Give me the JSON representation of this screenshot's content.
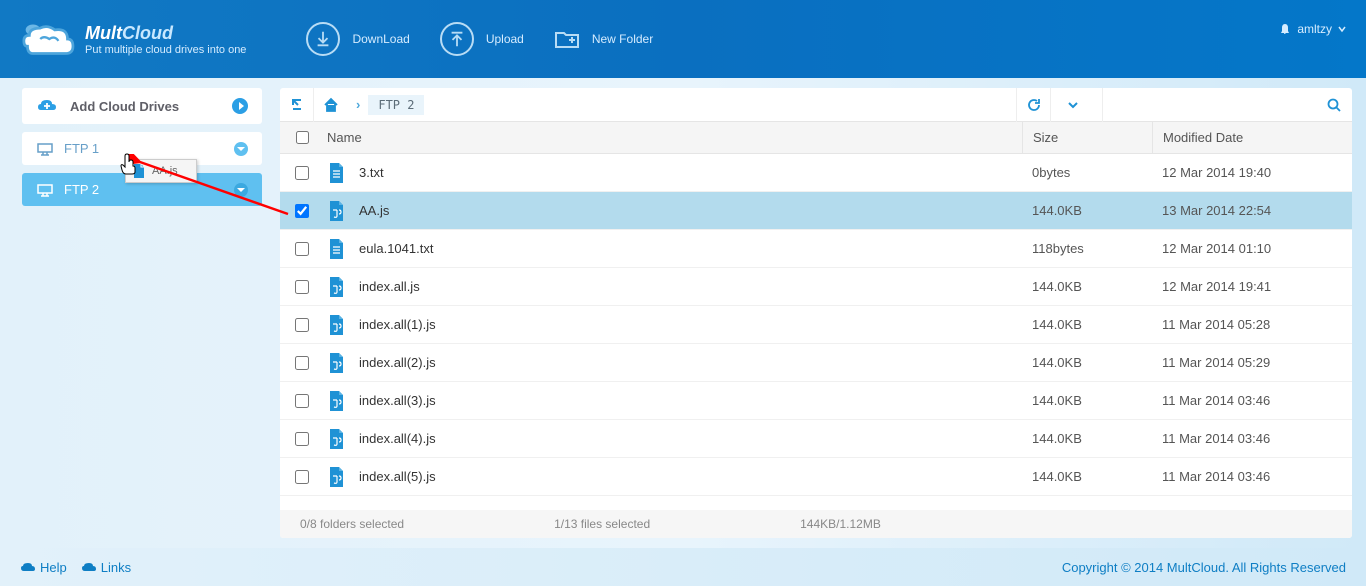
{
  "brand": {
    "name1": "Mult",
    "name2": "Cloud",
    "tagline": "Put multiple cloud drives into one"
  },
  "header": {
    "download": "DownLoad",
    "upload": "Upload",
    "newfolder": "New Folder",
    "username": "amltzy"
  },
  "sidebar": {
    "add": "Add Cloud Drives",
    "drives": [
      {
        "label": "FTP 1"
      },
      {
        "label": "FTP 2"
      }
    ]
  },
  "drag": {
    "filename": "AA.js"
  },
  "breadcrumb": {
    "current": "FTP 2"
  },
  "table": {
    "headers": {
      "name": "Name",
      "size": "Size",
      "date": "Modified Date"
    },
    "rows": [
      {
        "name": "3.txt",
        "size": "0bytes",
        "date": "12 Mar 2014 19:40",
        "type": "txt",
        "selected": false
      },
      {
        "name": "AA.js",
        "size": "144.0KB",
        "date": "13 Mar 2014 22:54",
        "type": "js",
        "selected": true
      },
      {
        "name": "eula.1041.txt",
        "size": "118bytes",
        "date": "12 Mar 2014 01:10",
        "type": "txt",
        "selected": false
      },
      {
        "name": "index.all.js",
        "size": "144.0KB",
        "date": "12 Mar 2014 19:41",
        "type": "js",
        "selected": false
      },
      {
        "name": "index.all(1).js",
        "size": "144.0KB",
        "date": "11 Mar 2014 05:28",
        "type": "js",
        "selected": false
      },
      {
        "name": "index.all(2).js",
        "size": "144.0KB",
        "date": "11 Mar 2014 05:29",
        "type": "js",
        "selected": false
      },
      {
        "name": "index.all(3).js",
        "size": "144.0KB",
        "date": "11 Mar 2014 03:46",
        "type": "js",
        "selected": false
      },
      {
        "name": "index.all(4).js",
        "size": "144.0KB",
        "date": "11 Mar 2014 03:46",
        "type": "js",
        "selected": false
      },
      {
        "name": "index.all(5).js",
        "size": "144.0KB",
        "date": "11 Mar 2014 03:46",
        "type": "js",
        "selected": false
      }
    ]
  },
  "status": {
    "folders": "0/8 folders selected",
    "files": "1/13 files selected",
    "size": "144KB/1.12MB"
  },
  "footer": {
    "help": "Help",
    "links": "Links",
    "copyright": "Copyright © 2014 MultCloud. All Rights Reserved"
  }
}
